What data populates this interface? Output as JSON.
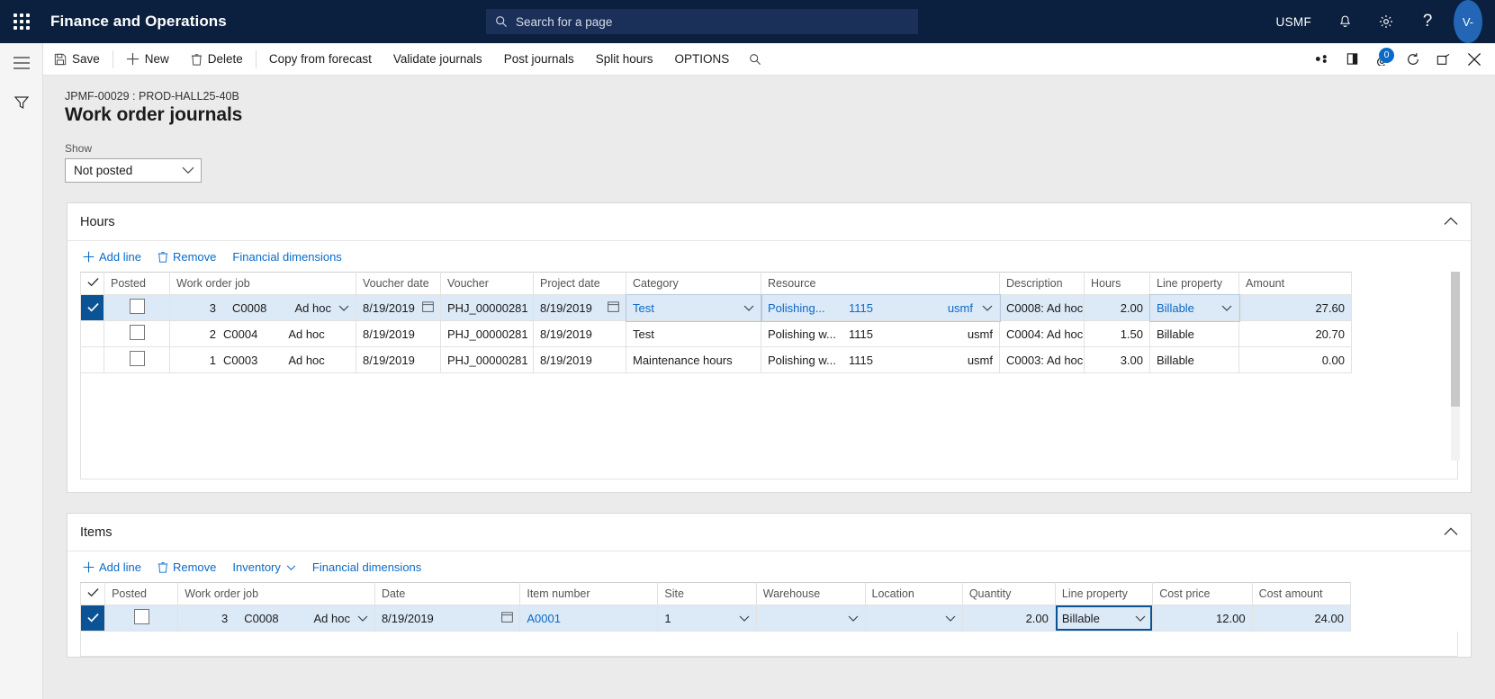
{
  "topnav": {
    "waffle_name": "app-launcher",
    "brand": "Finance and Operations",
    "search_placeholder": "Search for a page",
    "company": "USMF",
    "avatar_initials": "V-"
  },
  "commandbar": {
    "items": [
      {
        "label": "Save",
        "icon": "save-icon"
      },
      {
        "label": "New",
        "icon": "plus-icon"
      },
      {
        "label": "Delete",
        "icon": "trash-icon"
      },
      {
        "label": "Copy from forecast",
        "icon": ""
      },
      {
        "label": "Validate journals",
        "icon": ""
      },
      {
        "label": "Post journals",
        "icon": ""
      },
      {
        "label": "Split hours",
        "icon": ""
      },
      {
        "label": "OPTIONS",
        "icon": ""
      }
    ],
    "search_icon": "search-icon",
    "right_icons": [
      "personalize-icon",
      "open-in-new-window-icon",
      "attachments-icon",
      "refresh-icon",
      "popout-icon",
      "close-icon"
    ],
    "attachment_count": "0"
  },
  "page": {
    "breadcrumb": "JPMF-00029 : PROD-HALL25-40B",
    "title": "Work order journals",
    "show_label": "Show",
    "show_value": "Not posted"
  },
  "hours": {
    "title": "Hours",
    "toolbar": [
      {
        "label": "Add line",
        "icon": "plus-icon"
      },
      {
        "label": "Remove",
        "icon": "trash-icon"
      },
      {
        "label": "Financial dimensions",
        "icon": ""
      }
    ],
    "columns": [
      "Posted",
      "Work order job",
      "Voucher date",
      "Voucher",
      "Project date",
      "Category",
      "Resource",
      "Description",
      "Hours",
      "Line property",
      "Amount"
    ],
    "rows": [
      {
        "selected": true,
        "posted": false,
        "job_num": "3",
        "job_code": "C0008",
        "job_type": "Ad hoc",
        "voucher_date": "8/19/2019",
        "voucher": "PHJ_00000281",
        "project_date": "8/19/2019",
        "category": "Test",
        "resource": "Polishing...",
        "resource_id": "1115",
        "resource_company": "usmf",
        "description": "C0008: Ad hoc",
        "hours": "2.00",
        "line_property": "Billable",
        "amount": "27.60"
      },
      {
        "selected": false,
        "posted": false,
        "job_num": "2",
        "job_code": "C0004",
        "job_type": "Ad hoc",
        "voucher_date": "8/19/2019",
        "voucher": "PHJ_00000281",
        "project_date": "8/19/2019",
        "category": "Test",
        "resource": "Polishing w...",
        "resource_id": "1115",
        "resource_company": "usmf",
        "description": "C0004: Ad hoc",
        "hours": "1.50",
        "line_property": "Billable",
        "amount": "20.70"
      },
      {
        "selected": false,
        "posted": false,
        "job_num": "1",
        "job_code": "C0003",
        "job_type": "Ad hoc",
        "voucher_date": "8/19/2019",
        "voucher": "PHJ_00000281",
        "project_date": "8/19/2019",
        "category": "Maintenance hours",
        "resource": "Polishing w...",
        "resource_id": "1115",
        "resource_company": "usmf",
        "description": "C0003: Ad hoc",
        "hours": "3.00",
        "line_property": "Billable",
        "amount": "0.00"
      }
    ]
  },
  "items": {
    "title": "Items",
    "toolbar": [
      {
        "label": "Add line",
        "icon": "plus-icon"
      },
      {
        "label": "Remove",
        "icon": "trash-icon"
      },
      {
        "label": "Inventory",
        "icon": "chevron-down-icon"
      },
      {
        "label": "Financial dimensions",
        "icon": ""
      }
    ],
    "columns": [
      "Posted",
      "Work order job",
      "Date",
      "Item number",
      "Site",
      "Warehouse",
      "Location",
      "Quantity",
      "Line property",
      "Cost price",
      "Cost amount"
    ],
    "rows": [
      {
        "selected": true,
        "posted": false,
        "job_num": "3",
        "job_code": "C0008",
        "job_type": "Ad hoc",
        "date": "8/19/2019",
        "item_number": "A0001",
        "site": "1",
        "warehouse": "",
        "location": "",
        "quantity": "2.00",
        "line_property": "Billable",
        "cost_price": "12.00",
        "cost_amount": "24.00"
      }
    ]
  },
  "colors": {
    "nav_bg": "#0b1f3f",
    "accent": "#0b6ac8",
    "selection_row": "#dce9f7",
    "selection_bar": "#0b5394"
  }
}
